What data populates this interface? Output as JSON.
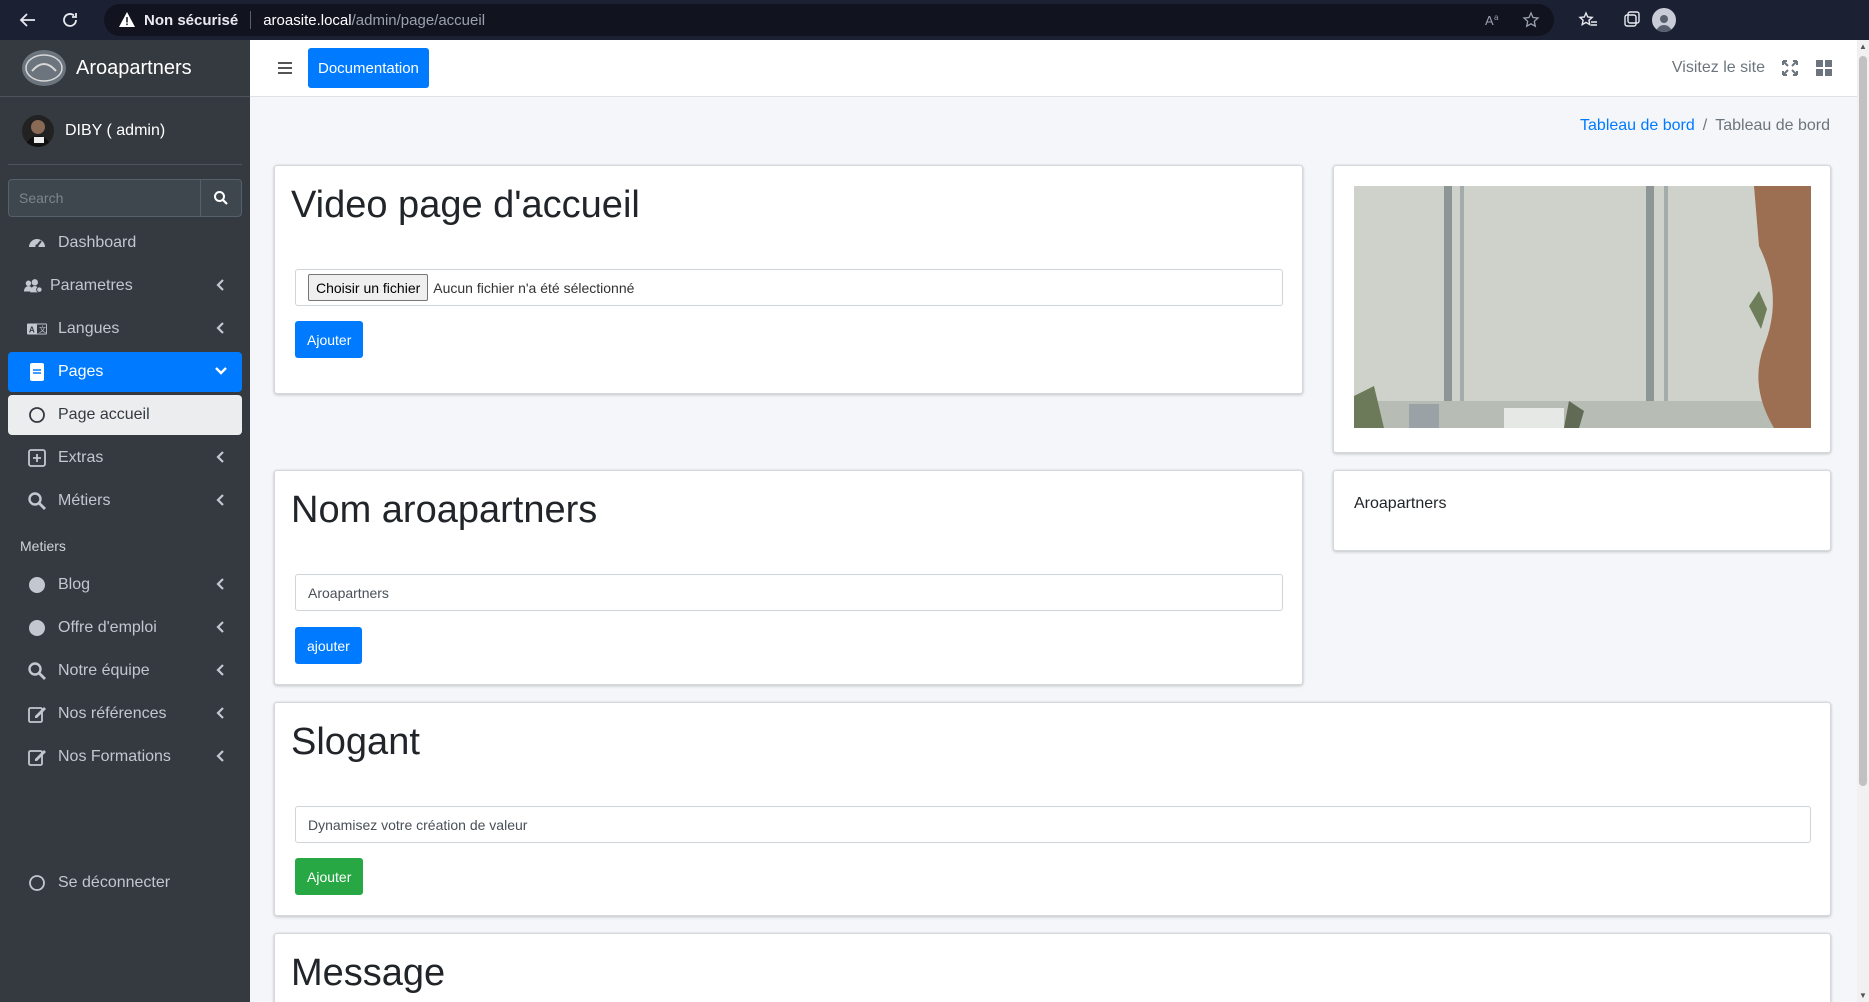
{
  "browser": {
    "not_secure": "Non sécurisé",
    "url_host": "aroasite.local",
    "url_path": "/admin/page/accueil"
  },
  "sidebar": {
    "brand": "Aroapartners",
    "user": "DIBY ( admin)",
    "search_placeholder": "Search",
    "items": [
      {
        "label": "Dashboard",
        "icon": "dashboard-icon"
      },
      {
        "label": "Parametres",
        "icon": "users-cog-icon"
      },
      {
        "label": "Langues",
        "icon": "language-icon"
      },
      {
        "label": "Pages",
        "icon": "file-icon"
      },
      {
        "label": "Page accueil",
        "icon": "circle-icon"
      },
      {
        "label": "Extras",
        "icon": "plus-square-icon"
      },
      {
        "label": "Métiers",
        "icon": "search-icon"
      }
    ],
    "section_header": "Metiers",
    "items2": [
      {
        "label": "Blog",
        "icon": "circle-icon"
      },
      {
        "label": "Offre d'emploi",
        "icon": "circle-icon"
      },
      {
        "label": "Notre équipe",
        "icon": "search-icon"
      },
      {
        "label": "Nos références",
        "icon": "edit-icon"
      },
      {
        "label": "Nos Formations",
        "icon": "edit-icon"
      }
    ],
    "logout": "Se déconnecter"
  },
  "topbar": {
    "doc_button": "Documentation",
    "visit_link": "Visitez le site"
  },
  "breadcrumb": {
    "link": "Tableau de bord",
    "separator": "/",
    "current": "Tableau de bord"
  },
  "video_card": {
    "title": "Video page d'accueil",
    "file_button": "Choisir un fichier",
    "file_status": "Aucun fichier n'a été sélectionné",
    "submit": "Ajouter"
  },
  "name_card": {
    "title": "Nom aroapartners",
    "value": "Aroapartners",
    "submit": "ajouter"
  },
  "name_preview": {
    "text": "Aroapartners"
  },
  "slogan_card": {
    "title": "Slogant",
    "value": "Dynamisez votre création de valeur",
    "submit": "Ajouter"
  },
  "message_card": {
    "title": "Message"
  },
  "colors": {
    "primary": "#007bff",
    "success": "#28a745",
    "sidebar": "#343a40",
    "browser_bar": "#1c2033"
  }
}
